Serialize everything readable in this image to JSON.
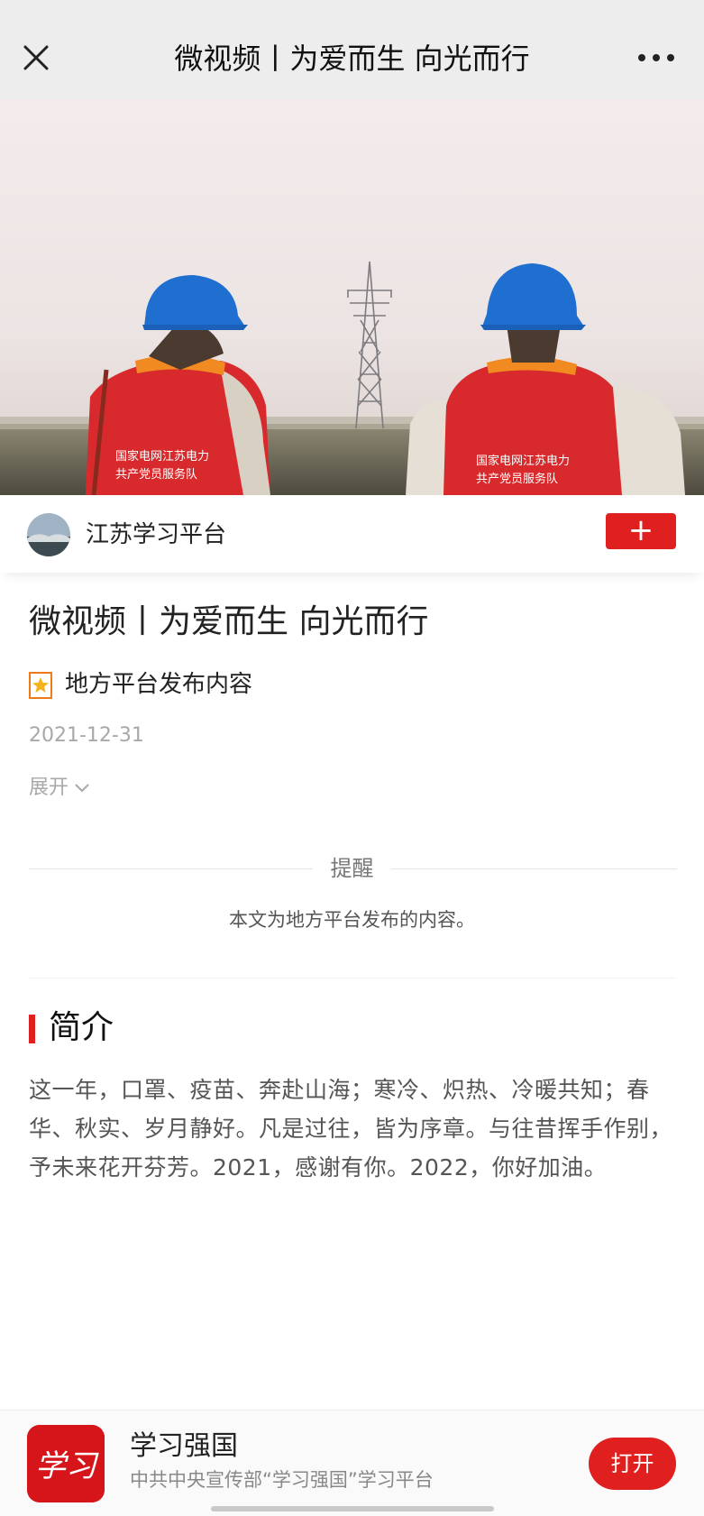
{
  "header": {
    "title": "微视频丨为爱而生 向光而行",
    "close_icon": "close-icon",
    "more_icon": "more-dots-icon"
  },
  "video": {
    "vest_left_line1": "国家电网江苏电力",
    "vest_left_line2": "共产党员服务队",
    "vest_right_line1": "国家电网江苏电力",
    "vest_right_line2": "共产党员服务队"
  },
  "account": {
    "name": "江苏学习平台",
    "follow_label": "+"
  },
  "article": {
    "title": "微视频丨为爱而生 向光而行",
    "source_label": "地方平台发布内容",
    "date": "2021-12-31",
    "expand_label": "展开"
  },
  "reminder": {
    "title": "提醒",
    "text": "本文为地方平台发布的内容。"
  },
  "intro": {
    "title": "简介",
    "body": "这一年，口罩、疫苗、奔赴山海；寒冷、炽热、冷暖共知；春华、秋实、岁月静好。凡是过往，皆为序章。与往昔挥手作别，予未来花开芬芳。2021，感谢有你。2022，你好加油。"
  },
  "bottom_banner": {
    "app_name": "学习强国",
    "app_desc": "中共中央宣传部“学习强国”学习平台",
    "open_label": "打开",
    "logo_text": "学习"
  },
  "colors": {
    "accent_red": "#e0201e",
    "topbar_bg": "#ededed"
  }
}
